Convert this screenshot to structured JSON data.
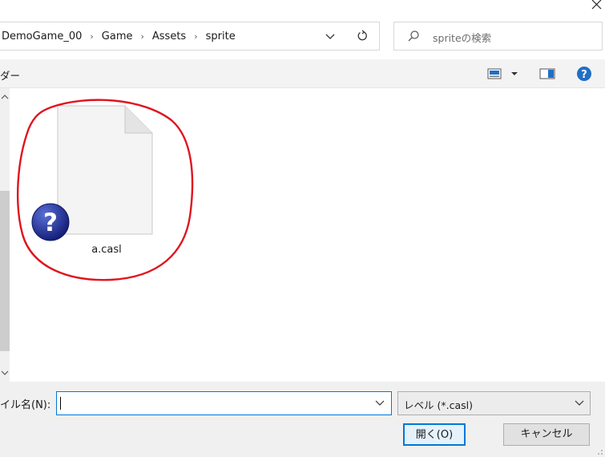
{
  "window": {
    "close_icon": "close-icon"
  },
  "address": {
    "crumbs": [
      "DemoGame_00",
      "Game",
      "Assets",
      "sprite"
    ],
    "separator": "›",
    "dropdown_icon": "chevron-down-icon",
    "refresh_icon": "refresh-icon"
  },
  "search": {
    "placeholder": "spriteの検索",
    "icon": "search-icon"
  },
  "toolbar": {
    "label": "ダー",
    "view_icon": "view-options-icon",
    "pane_icon": "preview-pane-icon",
    "help_icon": "help-icon"
  },
  "files": [
    {
      "name": "a.casl",
      "icon": "unknown-file-icon",
      "badge": "?"
    }
  ],
  "bottom": {
    "filename_label": "イル名(N):",
    "filename_value": "",
    "filter_value": "レベル (*.casl)",
    "open_label": "開く(O)",
    "cancel_label": "キャンセル"
  },
  "colors": {
    "accent": "#0078d7",
    "highlight_circle": "#e0141e",
    "toolbar_bg": "#f3f3f3",
    "bottom_bg": "#f0f0f0"
  }
}
